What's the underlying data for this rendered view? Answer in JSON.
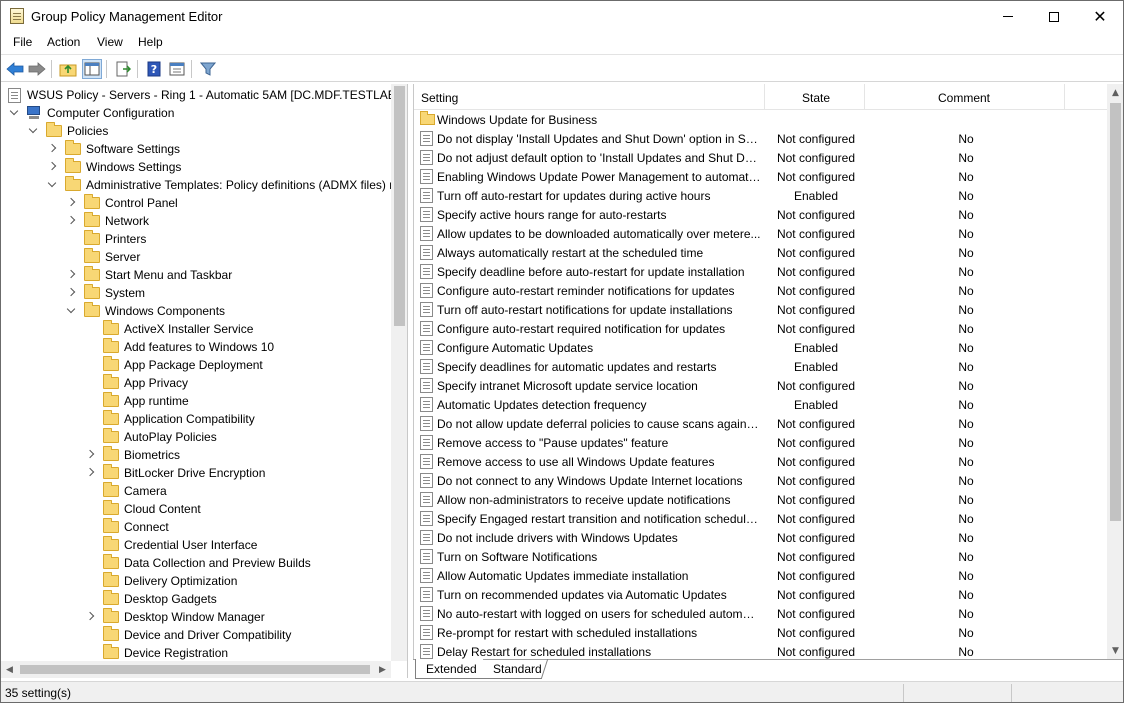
{
  "window": {
    "title": "Group Policy Management Editor",
    "icon": "policy-document-icon"
  },
  "menu": [
    "File",
    "Action",
    "View",
    "Help"
  ],
  "toolbar_icons": [
    "back-arrow-icon",
    "forward-arrow-icon",
    "up-folder-icon",
    "show-hide-tree-icon",
    "export-list-icon",
    "help-icon",
    "properties-icon",
    "filter-icon"
  ],
  "tree": [
    {
      "label": "WSUS Policy - Servers - Ring 1 - Automatic 5AM [DC.MDF.TESTLAB.L",
      "level": 0,
      "icon": "policy-doc-icon",
      "expander": "none"
    },
    {
      "label": "Computer Configuration",
      "level": 0,
      "icon": "computer-icon",
      "expander": "open"
    },
    {
      "label": "Policies",
      "level": 1,
      "icon": "folder-icon",
      "expander": "open"
    },
    {
      "label": "Software Settings",
      "level": 2,
      "icon": "folder-icon",
      "expander": "closed"
    },
    {
      "label": "Windows Settings",
      "level": 2,
      "icon": "folder-icon",
      "expander": "closed"
    },
    {
      "label": "Administrative Templates: Policy definitions (ADMX files) r",
      "level": 2,
      "icon": "folder-icon",
      "expander": "open"
    },
    {
      "label": "Control Panel",
      "level": 3,
      "icon": "folder-icon",
      "expander": "closed"
    },
    {
      "label": "Network",
      "level": 3,
      "icon": "folder-icon",
      "expander": "closed"
    },
    {
      "label": "Printers",
      "level": 3,
      "icon": "folder-icon",
      "expander": "none"
    },
    {
      "label": "Server",
      "level": 3,
      "icon": "folder-icon",
      "expander": "none"
    },
    {
      "label": "Start Menu and Taskbar",
      "level": 3,
      "icon": "folder-icon",
      "expander": "closed"
    },
    {
      "label": "System",
      "level": 3,
      "icon": "folder-icon",
      "expander": "closed"
    },
    {
      "label": "Windows Components",
      "level": 3,
      "icon": "folder-icon",
      "expander": "open"
    },
    {
      "label": "ActiveX Installer Service",
      "level": 4,
      "icon": "folder-icon",
      "expander": "none"
    },
    {
      "label": "Add features to Windows 10",
      "level": 4,
      "icon": "folder-icon",
      "expander": "none"
    },
    {
      "label": "App Package Deployment",
      "level": 4,
      "icon": "folder-icon",
      "expander": "none"
    },
    {
      "label": "App Privacy",
      "level": 4,
      "icon": "folder-icon",
      "expander": "none"
    },
    {
      "label": "App runtime",
      "level": 4,
      "icon": "folder-icon",
      "expander": "none"
    },
    {
      "label": "Application Compatibility",
      "level": 4,
      "icon": "folder-icon",
      "expander": "none"
    },
    {
      "label": "AutoPlay Policies",
      "level": 4,
      "icon": "folder-icon",
      "expander": "none"
    },
    {
      "label": "Biometrics",
      "level": 4,
      "icon": "folder-icon",
      "expander": "closed"
    },
    {
      "label": "BitLocker Drive Encryption",
      "level": 4,
      "icon": "folder-icon",
      "expander": "closed"
    },
    {
      "label": "Camera",
      "level": 4,
      "icon": "folder-icon",
      "expander": "none"
    },
    {
      "label": "Cloud Content",
      "level": 4,
      "icon": "folder-icon",
      "expander": "none"
    },
    {
      "label": "Connect",
      "level": 4,
      "icon": "folder-icon",
      "expander": "none"
    },
    {
      "label": "Credential User Interface",
      "level": 4,
      "icon": "folder-icon",
      "expander": "none"
    },
    {
      "label": "Data Collection and Preview Builds",
      "level": 4,
      "icon": "folder-icon",
      "expander": "none"
    },
    {
      "label": "Delivery Optimization",
      "level": 4,
      "icon": "folder-icon",
      "expander": "none"
    },
    {
      "label": "Desktop Gadgets",
      "level": 4,
      "icon": "folder-icon",
      "expander": "none"
    },
    {
      "label": "Desktop Window Manager",
      "level": 4,
      "icon": "folder-icon",
      "expander": "closed"
    },
    {
      "label": "Device and Driver Compatibility",
      "level": 4,
      "icon": "folder-icon",
      "expander": "none"
    },
    {
      "label": "Device Registration",
      "level": 4,
      "icon": "folder-icon",
      "expander": "none"
    }
  ],
  "list": {
    "headers": {
      "setting": "Setting",
      "state": "State",
      "comment": "Comment"
    },
    "folder_row": "Windows Update for Business",
    "rows": [
      {
        "setting": "Do not display 'Install Updates and Shut Down' option in Sh...",
        "state": "Not configured",
        "comment": "No"
      },
      {
        "setting": "Do not adjust default option to 'Install Updates and Shut Do...",
        "state": "Not configured",
        "comment": "No"
      },
      {
        "setting": "Enabling Windows Update Power Management to automati...",
        "state": "Not configured",
        "comment": "No"
      },
      {
        "setting": "Turn off auto-restart for updates during active hours",
        "state": "Enabled",
        "comment": "No"
      },
      {
        "setting": "Specify active hours range for auto-restarts",
        "state": "Not configured",
        "comment": "No"
      },
      {
        "setting": "Allow updates to be downloaded automatically over metere...",
        "state": "Not configured",
        "comment": "No"
      },
      {
        "setting": "Always automatically restart at the scheduled time",
        "state": "Not configured",
        "comment": "No"
      },
      {
        "setting": "Specify deadline before auto-restart for update installation",
        "state": "Not configured",
        "comment": "No"
      },
      {
        "setting": "Configure auto-restart reminder notifications for updates",
        "state": "Not configured",
        "comment": "No"
      },
      {
        "setting": "Turn off auto-restart notifications for update installations",
        "state": "Not configured",
        "comment": "No"
      },
      {
        "setting": "Configure auto-restart required notification for updates",
        "state": "Not configured",
        "comment": "No"
      },
      {
        "setting": "Configure Automatic Updates",
        "state": "Enabled",
        "comment": "No"
      },
      {
        "setting": "Specify deadlines for automatic updates and restarts",
        "state": "Enabled",
        "comment": "No"
      },
      {
        "setting": "Specify intranet Microsoft update service location",
        "state": "Not configured",
        "comment": "No"
      },
      {
        "setting": "Automatic Updates detection frequency",
        "state": "Enabled",
        "comment": "No"
      },
      {
        "setting": "Do not allow update deferral policies to cause scans against ...",
        "state": "Not configured",
        "comment": "No"
      },
      {
        "setting": "Remove access to \"Pause updates\" feature",
        "state": "Not configured",
        "comment": "No"
      },
      {
        "setting": "Remove access to use all Windows Update features",
        "state": "Not configured",
        "comment": "No"
      },
      {
        "setting": "Do not connect to any Windows Update Internet locations",
        "state": "Not configured",
        "comment": "No"
      },
      {
        "setting": "Allow non-administrators to receive update notifications",
        "state": "Not configured",
        "comment": "No"
      },
      {
        "setting": "Specify Engaged restart transition and notification schedule ...",
        "state": "Not configured",
        "comment": "No"
      },
      {
        "setting": "Do not include drivers with Windows Updates",
        "state": "Not configured",
        "comment": "No"
      },
      {
        "setting": "Turn on Software Notifications",
        "state": "Not configured",
        "comment": "No"
      },
      {
        "setting": "Allow Automatic Updates immediate installation",
        "state": "Not configured",
        "comment": "No"
      },
      {
        "setting": "Turn on recommended updates via Automatic Updates",
        "state": "Not configured",
        "comment": "No"
      },
      {
        "setting": "No auto-restart with logged on users for scheduled automat...",
        "state": "Not configured",
        "comment": "No"
      },
      {
        "setting": "Re-prompt for restart with scheduled installations",
        "state": "Not configured",
        "comment": "No"
      },
      {
        "setting": "Delay Restart for scheduled installations",
        "state": "Not configured",
        "comment": "No"
      }
    ]
  },
  "tabs": [
    "Extended",
    "Standard"
  ],
  "status": "35 setting(s)"
}
